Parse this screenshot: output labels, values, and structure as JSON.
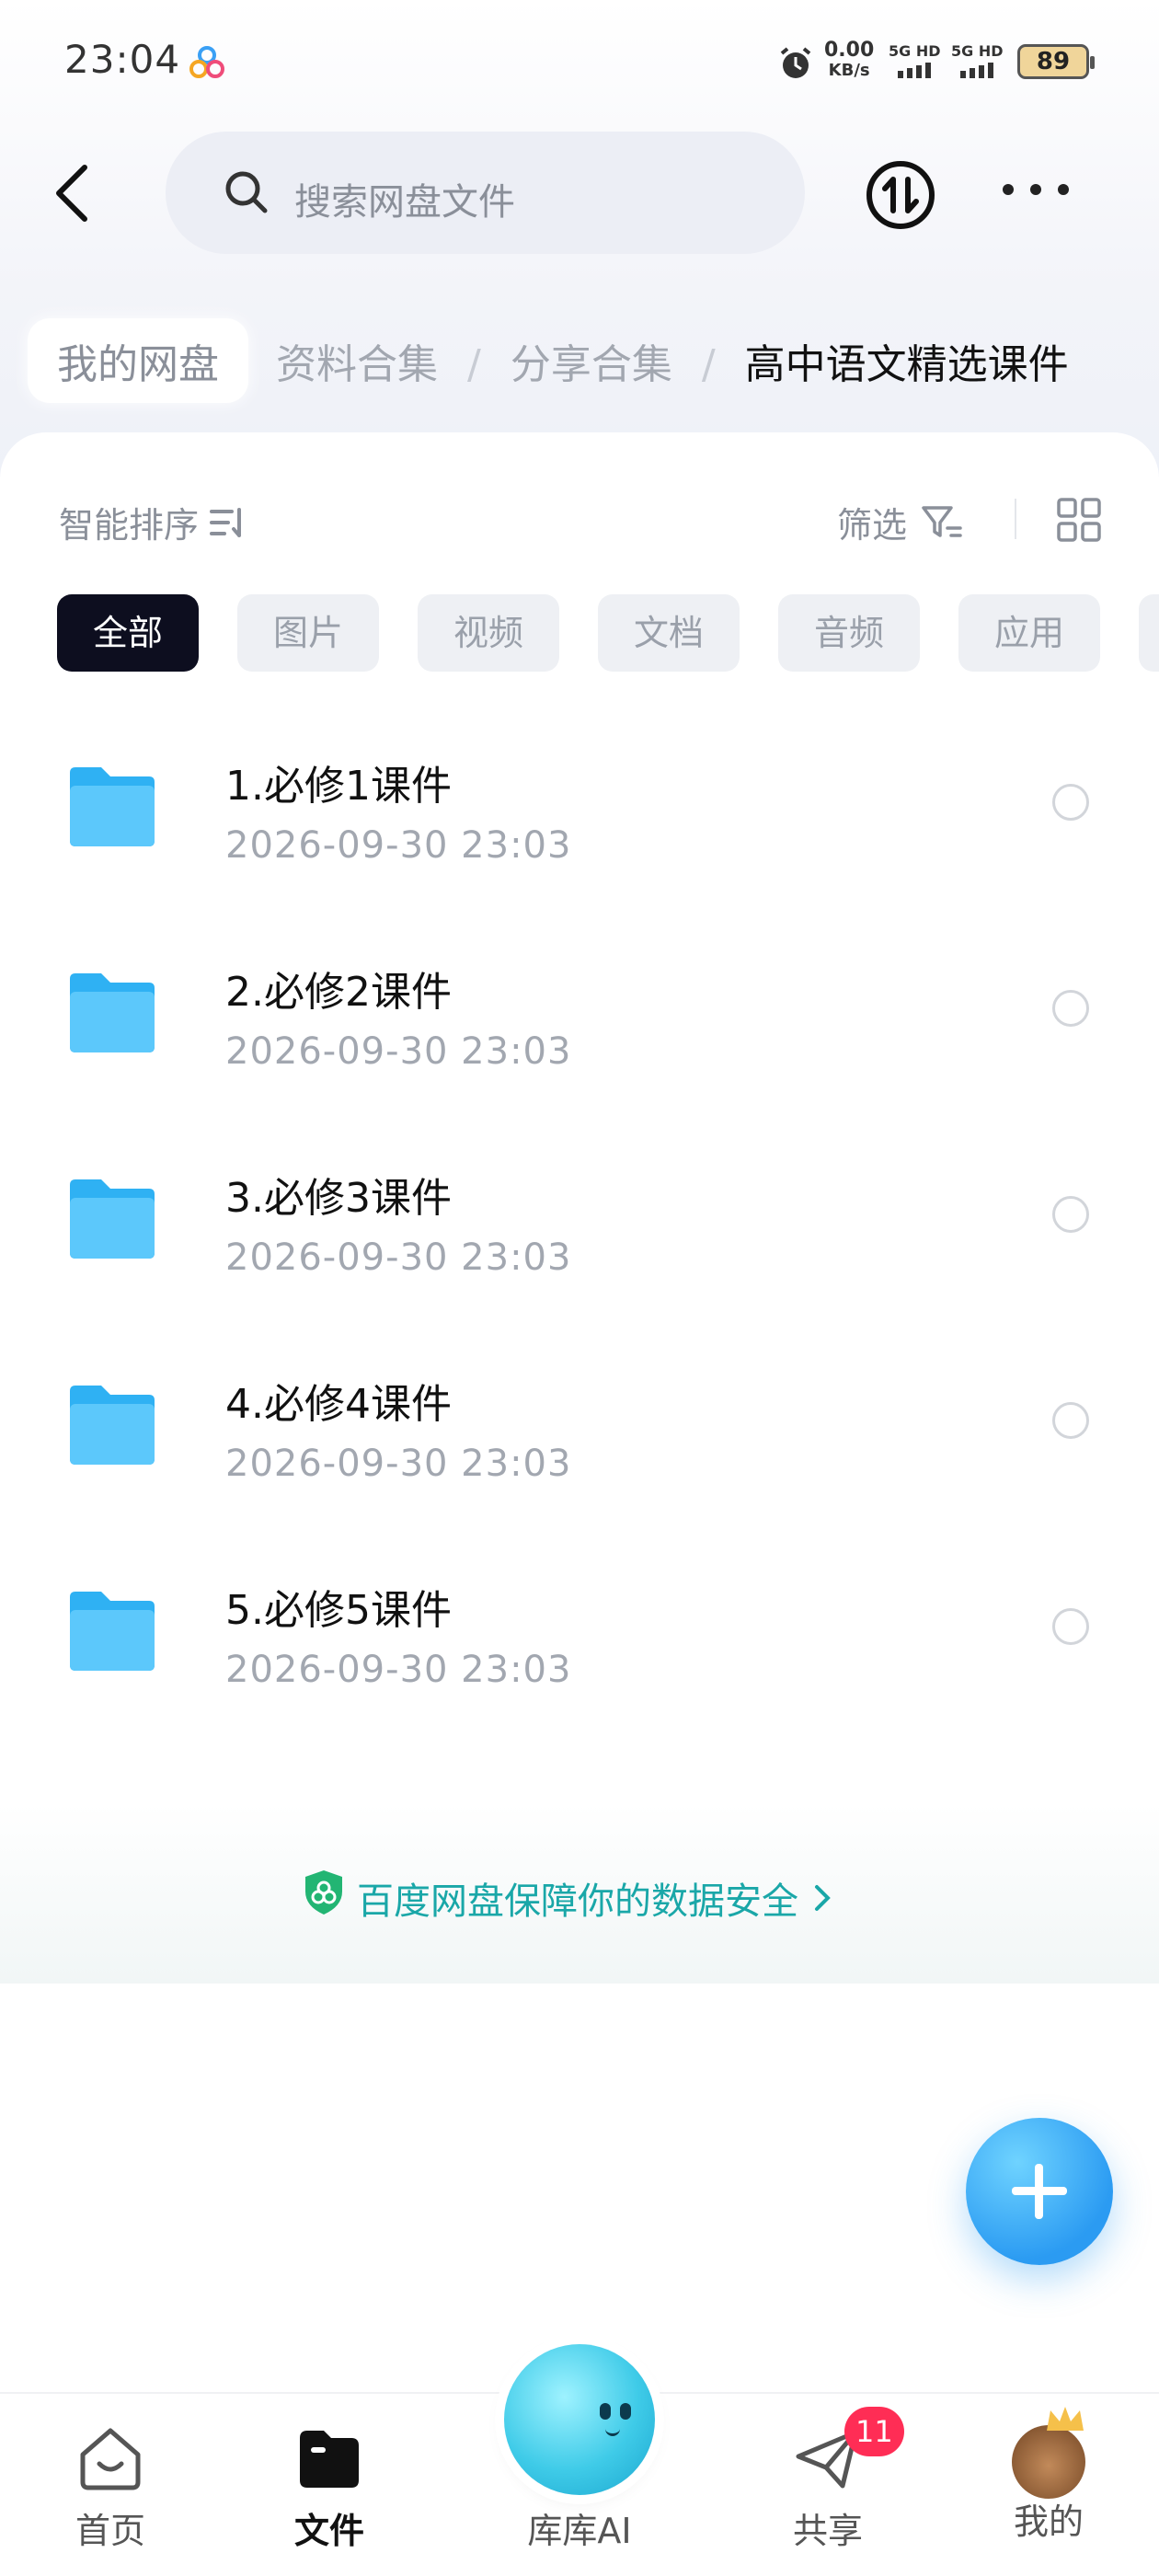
{
  "status_bar": {
    "time": "23:04",
    "net_speed_value": "0.00",
    "net_speed_unit": "KB/s",
    "sim1": "5G HD",
    "sim2": "5G HD",
    "battery": "89"
  },
  "header": {
    "search_placeholder": "搜索网盘文件",
    "back_icon": "chevron-left-icon",
    "transfer_icon": "transfer-icon",
    "more_icon": "more-icon"
  },
  "breadcrumb": {
    "home": "我的网盘",
    "items": [
      "资料合集",
      "分享合集"
    ],
    "current": "高中语文精选课件",
    "separator": "/"
  },
  "toolbar": {
    "sort_label": "智能排序",
    "filter_label": "筛选"
  },
  "chips": [
    "全部",
    "图片",
    "视频",
    "文档",
    "音频",
    "应用"
  ],
  "files": [
    {
      "name": "1.必修1课件",
      "date": "2026-09-30  23:03"
    },
    {
      "name": "2.必修2课件",
      "date": "2026-09-30  23:03"
    },
    {
      "name": "3.必修3课件",
      "date": "2026-09-30  23:03"
    },
    {
      "name": "4.必修4课件",
      "date": "2026-09-30  23:03"
    },
    {
      "name": "5.必修5课件",
      "date": "2026-09-30  23:03"
    }
  ],
  "banner": {
    "text": "百度网盘保障你的数据安全"
  },
  "tabbar": {
    "home": "首页",
    "files": "文件",
    "ai": "库库AI",
    "share": "共享",
    "share_badge": "11",
    "me": "我的"
  },
  "colors": {
    "accent": "#2b9bf2",
    "active_chip": "#0d0e1f",
    "badge": "#ff2d55",
    "banner_text": "#1aa7a8"
  }
}
